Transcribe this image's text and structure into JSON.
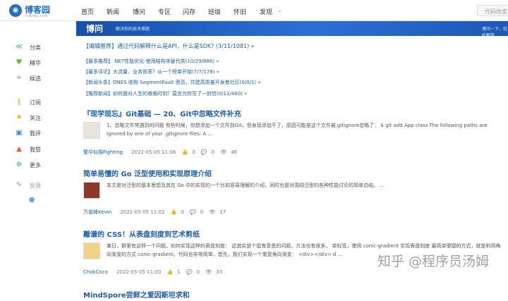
{
  "header": {
    "logo_text": "博客园",
    "logo_sub": "cnblogs.com",
    "nav": [
      "首页",
      "新闻",
      "博问",
      "专区",
      "闪存",
      "班级",
      "怀旧",
      "发现"
    ],
    "search_placeholder": "代码改变"
  },
  "banner": {
    "title": "博问",
    "subtitle": "解决你的技术难题",
    "right_text": "博问一下，轻松解答"
  },
  "sidebar": {
    "items": [
      {
        "label": "分类",
        "icon": "branch-icon",
        "color": "#4ca0e0"
      },
      {
        "label": "精华",
        "icon": "heart-icon",
        "color": "#5cbd3c"
      },
      {
        "label": "候选",
        "icon": "leaf-icon",
        "color": "#7bb8e8"
      },
      {
        "label": "订阅",
        "icon": "books-icon",
        "color": "#e8a13a"
      },
      {
        "label": "关注",
        "icon": "star-icon",
        "color": "#f0b400"
      },
      {
        "label": "我评",
        "icon": "comment-icon",
        "color": "#3a8fe0"
      },
      {
        "label": "我赞",
        "icon": "thumbs-up-icon",
        "color": "#e05c3a"
      },
      {
        "label": "更多",
        "icon": "plus-circle-icon",
        "color": "#3ab06a"
      },
      {
        "label": "反馈",
        "icon": "wrench-icon",
        "color": "#999999"
      }
    ],
    "bulb_icon": "lightbulb-icon"
  },
  "recommendations": [
    "【编辑推荐】通过代码解释什么是API，什么是SDK? (3/11/1081) »",
    "【最多推荐】.NET性能优化-使用结构体替代类(10/29/886) »",
    "【最多评论】大流量、业务效率？从一个榜单开始(7/7/178) »",
    "【新闻头条】ONES 收购 SegmentFault 思否，共建高质量开发者社区(0/0/1) »",
    "【推荐新闻】如何面对人生的艰难时刻？莫言为你写了一封信(0/11/460) »"
  ],
  "posts": [
    {
      "title": "『现学现忘』Git基础 — 20、Git中忽略文件补充",
      "summary": "1、忽略文件常遇到的问题 有些时候，你想添加一个文件到Git，但发现添加不了，原因可能是这个文件被.gitignore忽略了： $ git add App.class The following paths are ignored by one of your .gitignore files: A ...",
      "author": "繁华似锦Fighting",
      "date": "2022-05-05 11:06",
      "likes": "0",
      "comments": "0",
      "views": "46"
    },
    {
      "title": "简单易懂的 Go 泛型使用和实现原理介绍",
      "summary": "本文是对泛型的基本思想及其在 Go 中的实现的一个比较容易理解的介绍，同时也是对围绕泛型的各种性能讨论的简单总结。 ...",
      "author": "万俊峰Kevin",
      "date": "2022-05-05 11:02",
      "likes": "0",
      "comments": "0",
      "views": "17"
    },
    {
      "title": "離谱的 CSS！从表盘刻度到艺术剪纸",
      "summary": "某日，群里有这样一个问题，如何实现这样的表盘刻度： 这其实是个挺有意思的问题，方法也有很多。 单标签，使用 conic-gradient 实现表盘刻度 最简单便捷的方式，就是利用角向渐变的方式 conic-gradient。代码也非常简单，首先，我们实现一个重复角向渐变： <div></div> d ...",
      "author": "ChokCoco",
      "date": "2022-05-05 11:00",
      "likes": "1",
      "comments": "0",
      "views": "33"
    },
    {
      "title": "MindSpore尝鲜之爱因斯坦求和"
    }
  ],
  "watermark": "知乎 @程序员汤姆",
  "colors": {
    "link": "#1d5fa8",
    "banner": "#2c6fd6",
    "logo": "#1f6fc5"
  }
}
